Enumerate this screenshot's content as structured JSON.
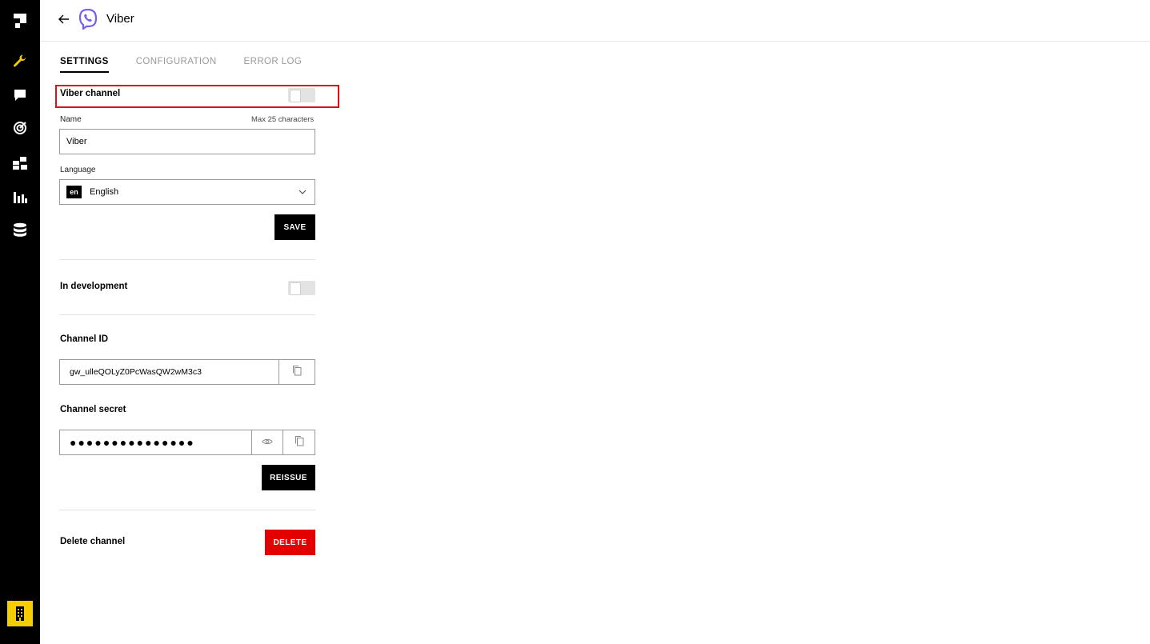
{
  "header": {
    "title": "Viber"
  },
  "tabs": [
    {
      "label": "SETTINGS",
      "active": true
    },
    {
      "label": "CONFIGURATION",
      "active": false
    },
    {
      "label": "ERROR LOG",
      "active": false
    }
  ],
  "channel_toggle": {
    "label": "Viber channel",
    "enabled": false
  },
  "name_field": {
    "label": "Name",
    "hint": "Max 25 characters",
    "value": "Viber"
  },
  "language_field": {
    "label": "Language",
    "code": "en",
    "value": "English"
  },
  "save_button": "SAVE",
  "dev_toggle": {
    "label": "In development",
    "enabled": false
  },
  "channel_id": {
    "label": "Channel ID",
    "value": "gw_ulleQOLyZ0PcWasQW2wM3c3"
  },
  "channel_secret": {
    "label": "Channel secret",
    "masked_value": "●●●●●●●●●●●●●●●"
  },
  "reissue_button": "REISSUE",
  "delete": {
    "label": "Delete channel",
    "button": "DELETE"
  },
  "colors": {
    "accent": "#f5cd00",
    "danger": "#e20000",
    "highlight": "#d8121b",
    "viber": "#7360f2"
  },
  "sidebar": {
    "icons": [
      "logo-icon",
      "wrench-icon",
      "chat-icon",
      "target-icon",
      "blocks-icon",
      "bar-chart-icon",
      "database-icon"
    ],
    "bottom_icon": "building-icon"
  }
}
